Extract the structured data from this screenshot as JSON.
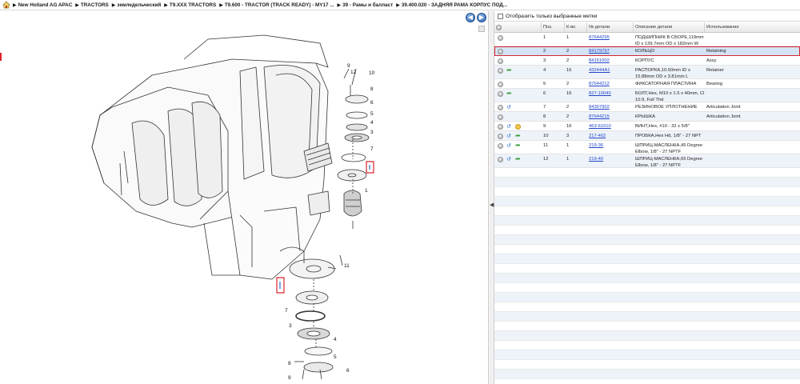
{
  "breadcrumb": [
    "New Holland AG APAC",
    "TRACTORS",
    "земледельческий",
    "T9.XXX TRACTORS",
    "T9.600 - TRACTOR (TRACK READY) - MY17 ...",
    "39 - Рамы и балласт",
    "39.400.020 - ЗАДНЯЯ РАМА КОРПУС ПОД..."
  ],
  "filter_label": "Отобразить только выбранные метки",
  "columns": {
    "pos": "Поз.",
    "qty": "К-во",
    "part_no": "№ детали",
    "description": "Описание детали",
    "usage": "Использование"
  },
  "callouts": [
    "10",
    "12",
    "9",
    "8",
    "6",
    "5",
    "4",
    "3",
    "7",
    "1",
    "11",
    "7",
    "3",
    "4",
    "5",
    "8",
    "9",
    "6"
  ],
  "rows": [
    {
      "pos": "1",
      "qty": "1",
      "part": "87644295",
      "desc": [
        "ПОДШИПНИК В СБОРЕ,119mm",
        "ID x 139.7mm OD x 182mm W"
      ],
      "usage": "",
      "icons": [
        "dot"
      ]
    },
    {
      "pos": "2",
      "qty": "2",
      "part": "84179797",
      "desc": [
        "КОЛЬЦО"
      ],
      "usage": "Retaining",
      "icons": [
        "dot"
      ],
      "selected": true
    },
    {
      "pos": "3",
      "qty": "2",
      "part": "84151002",
      "desc": [
        "КОРПУС"
      ],
      "usage": "Assy",
      "icons": [
        "dot"
      ]
    },
    {
      "pos": "4",
      "qty": "16",
      "part": "432444A1",
      "desc": [
        "РАСПОРКА,10.50mm ID x",
        "15.88mm OD x 3.81mm L"
      ],
      "usage": "Retainer",
      "icons": [
        "dot",
        "green"
      ]
    },
    {
      "pos": "5",
      "qty": "2",
      "part": "87644212",
      "desc": [
        "ФИКСАТОРНАЯ ПЛАСТИНА"
      ],
      "usage": "Bearing",
      "icons": [
        "dot"
      ]
    },
    {
      "pos": "6",
      "qty": "16",
      "part": "827-10040",
      "desc": [
        "БОЛТ,Hex, M10 x 1.5 x 40mm, Cl",
        "10.9, Full Thd"
      ],
      "usage": "",
      "icons": [
        "dot",
        "green"
      ]
    },
    {
      "pos": "7",
      "qty": "2",
      "part": "84307902",
      "desc": [
        "РЕЗИНОВОЕ УПЛОТНЕНИЕ"
      ],
      "usage": "Articulation Joint",
      "icons": [
        "dot",
        "blue"
      ]
    },
    {
      "pos": "8",
      "qty": "2",
      "part": "87644215",
      "desc": [
        "КРЫШКА"
      ],
      "usage": "Articulation Joint",
      "icons": [
        "dot"
      ]
    },
    {
      "pos": "9",
      "qty": "16",
      "part": "463-61010",
      "desc": [
        "ВИНТ,Hex, #10 - 32 x 5/8\""
      ],
      "usage": "",
      "icons": [
        "dot",
        "blue",
        "yellow"
      ]
    },
    {
      "pos": "10",
      "qty": "3",
      "part": "217-402",
      "desc": [
        "ПРОБКА,Hex Hd, 1/8\" - 27 NPT"
      ],
      "usage": "",
      "icons": [
        "dot",
        "blue",
        "green"
      ]
    },
    {
      "pos": "11",
      "qty": "1",
      "part": "219-36",
      "desc": [
        "ШПРИЦ-МАСЛЕНКА,45 Degree",
        "Elbow, 1/8\" - 27 NPTF"
      ],
      "usage": "",
      "icons": [
        "dot",
        "blue",
        "green"
      ]
    },
    {
      "pos": "12",
      "qty": "1",
      "part": "219-40",
      "desc": [
        "ШПРИЦ-МАСЛЕНКА,65 Degree",
        "Elbow, 1/8\" - 27 NPTF"
      ],
      "usage": "",
      "icons": [
        "dot",
        "blue",
        "green"
      ]
    }
  ],
  "colors": {
    "selection_outline": "#d9262c",
    "link": "#1f43c8",
    "row_alt": "#eef3fa"
  }
}
